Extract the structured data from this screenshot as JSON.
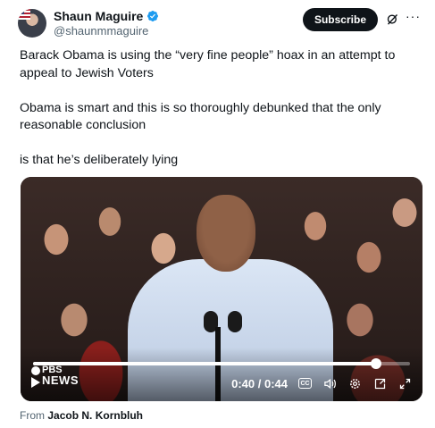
{
  "author": {
    "display_name": "Shaun Maguire",
    "handle": "@shaunmmaguire",
    "verified": true,
    "verified_color": "#1d9bf0"
  },
  "actions": {
    "subscribe_label": "Subscribe",
    "grok_icon": "grok-icon",
    "more_icon": "more-icon"
  },
  "tweet": {
    "paragraphs": [
      "Barack Obama is using the “very fine people” hoax in an attempt to appeal to Jewish Voters",
      "Obama is smart and this is so thoroughly debunked that the only reasonable conclusion",
      "is that he’s deliberately lying"
    ]
  },
  "video": {
    "brand_top": "PBS",
    "brand_bottom": "NEWS",
    "time_display": "0:40 / 0:44",
    "progress_fraction": 0.91,
    "controls": [
      "cc-icon",
      "volume-icon",
      "settings-icon",
      "picture-in-picture-icon",
      "fullscreen-icon"
    ]
  },
  "source": {
    "prefix": "From",
    "name": "Jacob N. Kornbluh"
  }
}
